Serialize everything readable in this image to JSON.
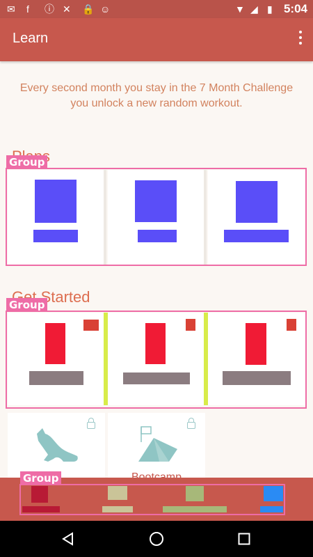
{
  "status_bar": {
    "time": "5:04",
    "icons": [
      "mail-icon",
      "facebook-icon",
      "alert-icon",
      "no-location-icon",
      "lock-icon",
      "android-icon",
      "wifi-icon",
      "no-sim-icon",
      "battery-icon"
    ]
  },
  "toolbar": {
    "title": "Learn",
    "menu_icon": "more-vert-icon"
  },
  "intro": {
    "text": "Every second month you stay in the 7 Month Challenge you unlock a new random workout."
  },
  "sections": {
    "plans": {
      "title": "Plans",
      "group_label": "Group"
    },
    "get_started": {
      "title": "Get Started",
      "group_label": "Group"
    },
    "workouts": {
      "item2_label": "Bootcamp"
    },
    "bottom": {
      "group_label": "Group"
    }
  },
  "colors": {
    "primary": "#c7584d",
    "group_outline": "#ee6ca6",
    "placeholder_blue": "#5a4ef8",
    "placeholder_red": "#f01b35",
    "placeholder_gray": "#8b7c80",
    "badge_red": "#d94135",
    "accent_yellow": "#d8ec4a"
  }
}
